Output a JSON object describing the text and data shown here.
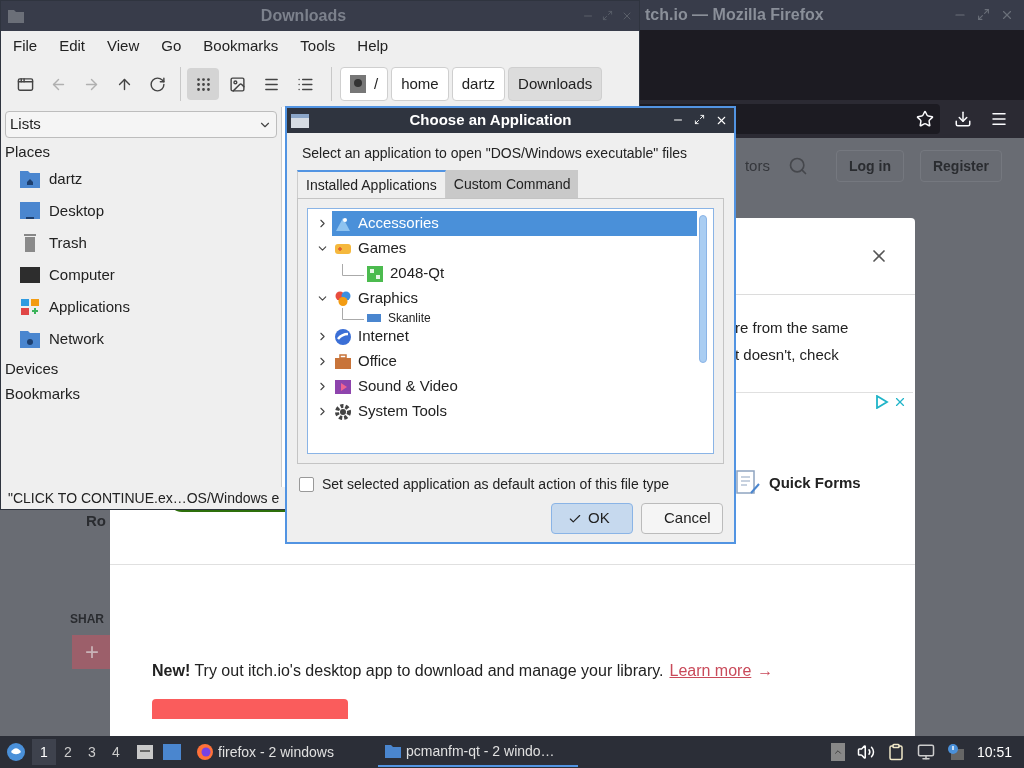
{
  "firefox": {
    "title": "tch.io — Mozilla Firefox",
    "search_hint": "tors",
    "header_buttons": [
      "Log in",
      "Register"
    ],
    "page_fragments": {
      "left_text": "Ro",
      "share_label": "SHAR",
      "share_button": "+"
    },
    "modal": {
      "text_lines": [
        "re from the same",
        "t doesn't, check"
      ],
      "ad_label": "Quick Forms",
      "promo": "**New!** Try out itch.io's desktop app to download and manage your library.",
      "promo_link": "Learn more",
      "promo_arrow": "→"
    }
  },
  "file_manager": {
    "title": "Downloads",
    "menu": [
      "File",
      "Edit",
      "View",
      "Go",
      "Bookmarks",
      "Tools",
      "Help"
    ],
    "nav_buttons": [
      {
        "kind": "new-tab",
        "disabled": false
      },
      {
        "kind": "back",
        "disabled": true
      },
      {
        "kind": "forward",
        "disabled": true
      },
      {
        "kind": "up",
        "disabled": false
      },
      {
        "kind": "reload",
        "disabled": false
      }
    ],
    "view_modes": [
      {
        "kind": "icon",
        "selected": true
      },
      {
        "kind": "thumbnail",
        "selected": false
      },
      {
        "kind": "compact",
        "selected": false
      },
      {
        "kind": "detail",
        "selected": false
      }
    ],
    "path": [
      {
        "label": "/",
        "kind": "root",
        "selected": false
      },
      {
        "label": "home",
        "kind": "dir",
        "selected": false
      },
      {
        "label": "dartz",
        "kind": "dir",
        "selected": false
      },
      {
        "label": "Downloads",
        "kind": "dir",
        "selected": true
      }
    ],
    "side_pane": {
      "mode": "Lists",
      "sections": [
        {
          "label": "Places",
          "items": [
            {
              "label": "dartz",
              "kind": "home"
            },
            {
              "label": "Desktop",
              "kind": "desktop"
            },
            {
              "label": "Trash",
              "kind": "trash"
            },
            {
              "label": "Computer",
              "kind": "computer"
            },
            {
              "label": "Applications",
              "kind": "apps"
            },
            {
              "label": "Network",
              "kind": "network"
            }
          ]
        },
        {
          "label": "Devices"
        },
        {
          "label": "Bookmarks"
        }
      ]
    },
    "status": "\"CLICK TO CONTINUE.ex…OS/Windows e"
  },
  "dialog": {
    "title": "Choose an Application",
    "prompt": "Select an application to open \"DOS/Windows executable\" files",
    "tabs": [
      {
        "label": "Installed Applications",
        "selected": true
      },
      {
        "label": "Custom Command",
        "selected": false
      }
    ],
    "tree": [
      {
        "label": "Accessories",
        "kind": "accessories",
        "expanded": false,
        "selected": true
      },
      {
        "label": "Games",
        "kind": "games",
        "expanded": true,
        "selected": false,
        "children": [
          {
            "label": "2048-Qt",
            "kind": "tiles",
            "selected": false
          }
        ]
      },
      {
        "label": "Graphics",
        "kind": "graphics",
        "expanded": true,
        "selected": false,
        "children": [
          {
            "label": "Skanlite",
            "kind": "scanner",
            "selected": false
          }
        ]
      },
      {
        "label": "Internet",
        "kind": "internet",
        "expanded": false,
        "selected": false
      },
      {
        "label": "Office",
        "kind": "office",
        "expanded": false,
        "selected": false
      },
      {
        "label": "Sound & Video",
        "kind": "media",
        "expanded": false,
        "selected": false
      },
      {
        "label": "System Tools",
        "kind": "gear",
        "expanded": false,
        "selected": false
      }
    ],
    "default_checkbox": {
      "label": "Set selected application as default action of this file type",
      "checked": false
    },
    "buttons": [
      {
        "label": "OK",
        "kind": "ok"
      },
      {
        "label": "Cancel",
        "kind": "cancel"
      }
    ]
  },
  "taskbar": {
    "workspaces": [
      {
        "label": "1",
        "selected": true
      },
      {
        "label": "2",
        "selected": false
      },
      {
        "label": "3",
        "selected": false
      },
      {
        "label": "4",
        "selected": false
      }
    ],
    "tasks": [
      {
        "label": "firefox - 2 windows",
        "kind": "firefox",
        "selected": false
      },
      {
        "label": "pcmanfm-qt - 2 windo…",
        "kind": "folder",
        "selected": true
      }
    ],
    "clock": "10:51"
  }
}
